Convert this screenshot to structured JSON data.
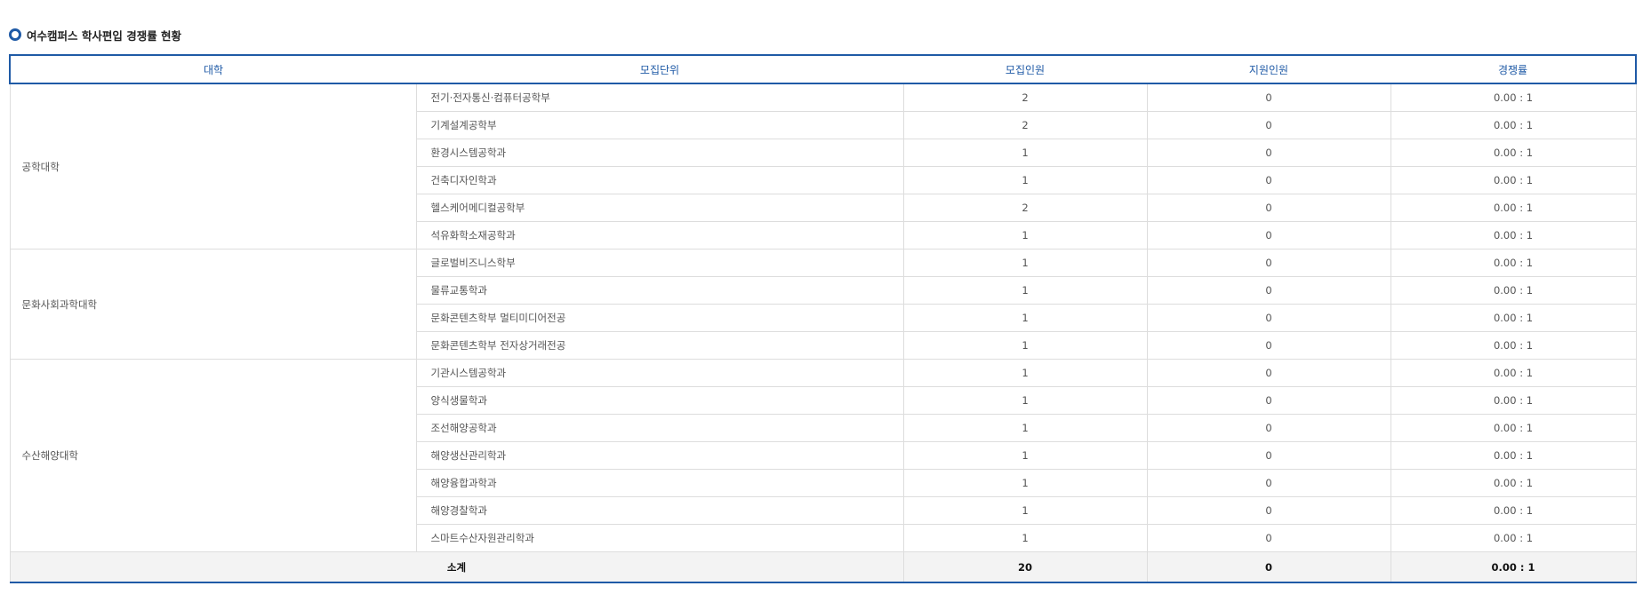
{
  "section_title": "여수캠퍼스 학사편입 경쟁률 현황",
  "table": {
    "headers": {
      "college": "대학",
      "unit": "모집단위",
      "quota": "모집인원",
      "applicants": "지원인원",
      "ratio": "경쟁률"
    },
    "groups": [
      {
        "college": "공학대학",
        "rows": [
          {
            "unit": "전기·전자통신·컴퓨터공학부",
            "quota": "2",
            "applicants": "0",
            "ratio": "0.00 : 1"
          },
          {
            "unit": "기계설계공학부",
            "quota": "2",
            "applicants": "0",
            "ratio": "0.00 : 1"
          },
          {
            "unit": "환경시스템공학과",
            "quota": "1",
            "applicants": "0",
            "ratio": "0.00 : 1"
          },
          {
            "unit": "건축디자인학과",
            "quota": "1",
            "applicants": "0",
            "ratio": "0.00 : 1"
          },
          {
            "unit": "헬스케어메디컬공학부",
            "quota": "2",
            "applicants": "0",
            "ratio": "0.00 : 1"
          },
          {
            "unit": "석유화학소재공학과",
            "quota": "1",
            "applicants": "0",
            "ratio": "0.00 : 1"
          }
        ]
      },
      {
        "college": "문화사회과학대학",
        "rows": [
          {
            "unit": "글로벌비즈니스학부",
            "quota": "1",
            "applicants": "0",
            "ratio": "0.00 : 1"
          },
          {
            "unit": "물류교통학과",
            "quota": "1",
            "applicants": "0",
            "ratio": "0.00 : 1"
          },
          {
            "unit": "문화콘텐츠학부 멀티미디어전공",
            "quota": "1",
            "applicants": "0",
            "ratio": "0.00 : 1"
          },
          {
            "unit": "문화콘텐츠학부 전자상거래전공",
            "quota": "1",
            "applicants": "0",
            "ratio": "0.00 : 1"
          }
        ]
      },
      {
        "college": "수산해양대학",
        "rows": [
          {
            "unit": "기관시스템공학과",
            "quota": "1",
            "applicants": "0",
            "ratio": "0.00 : 1"
          },
          {
            "unit": "양식생물학과",
            "quota": "1",
            "applicants": "0",
            "ratio": "0.00 : 1"
          },
          {
            "unit": "조선해양공학과",
            "quota": "1",
            "applicants": "0",
            "ratio": "0.00 : 1"
          },
          {
            "unit": "해양생산관리학과",
            "quota": "1",
            "applicants": "0",
            "ratio": "0.00 : 1"
          },
          {
            "unit": "해양융합과학과",
            "quota": "1",
            "applicants": "0",
            "ratio": "0.00 : 1"
          },
          {
            "unit": "해양경찰학과",
            "quota": "1",
            "applicants": "0",
            "ratio": "0.00 : 1"
          },
          {
            "unit": "스마트수산자원관리학과",
            "quota": "1",
            "applicants": "0",
            "ratio": "0.00 : 1"
          }
        ]
      }
    ],
    "total": {
      "label": "소계",
      "quota": "20",
      "applicants": "0",
      "ratio": "0.00 : 1"
    }
  },
  "colors": {
    "accent": "#1f5aa6",
    "border": "#dddddd",
    "total_background": "#f3f3f3"
  },
  "icons": {
    "title_bullet": "circle-bullet-icon"
  }
}
